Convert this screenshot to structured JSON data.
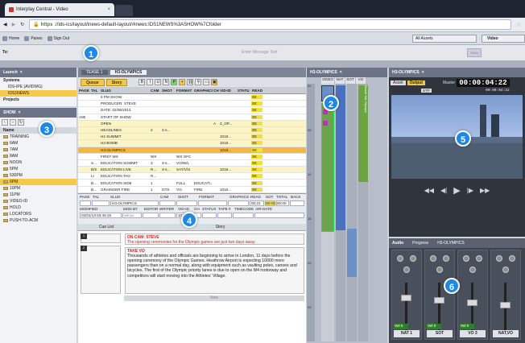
{
  "browser": {
    "tab_title": "Interplay Central - Video",
    "tab_close": "×",
    "url_scheme": "https",
    "url_rest": "://ids-ics/layout/inews-default-layout/#inews:IDS1NEWS%3ASHOW%7Cfolder"
  },
  "toolbar": {
    "home": "Home",
    "panes": "Panes",
    "sign_out": "Sign Out",
    "assets": "All Assets",
    "video": "Video"
  },
  "message": {
    "to_label": "To:",
    "placeholder": "Enter Message Text",
    "send": "Send"
  },
  "launch": {
    "title": "Launch",
    "systems": "Systems",
    "sys1": "IDS-IPE (AVIDWG)",
    "sys2": "IDS1NEWS",
    "projects": "Projects"
  },
  "show": {
    "title": "SHOW",
    "name_hdr": "Name",
    "items": [
      "TRAINING",
      "6AM",
      "7AM",
      "8AM",
      "NOON",
      "5PM",
      "530PM",
      "6PM",
      "10PM",
      "11PM",
      "VIDEO-ID",
      "HOLD",
      "LOCATORS",
      "PUSH-TO-ACM"
    ]
  },
  "story_panel": {
    "tab1": "TEASE 1",
    "tab2": "H3-OLYMPICS",
    "queue": "Queue",
    "story": "Story",
    "headers": [
      "PAGE",
      "TAL",
      "SLUG",
      "CAM",
      "SHOT",
      "FORMAT",
      "GRAPHICS",
      "CH",
      "VID-ID",
      "STATU",
      "READ"
    ],
    "rows": [
      {
        "page": "",
        "tal": "",
        "slug": "6 PM SHOW",
        "cam": "",
        "shot": "",
        "fmt": "",
        "gfx": "",
        "ch": "",
        "vid": "",
        "st": "",
        "rd": "00:",
        "c": "w"
      },
      {
        "page": "",
        "tal": "",
        "slug": "PRODUCER: STEVE",
        "cam": "",
        "shot": "",
        "fmt": "",
        "gfx": "",
        "ch": "",
        "vid": "",
        "st": "",
        "rd": "00:",
        "c": "w"
      },
      {
        "page": "",
        "tal": "",
        "slug": "DATE: 02/06/2013",
        "cam": "",
        "shot": "",
        "fmt": "",
        "gfx": "",
        "ch": "",
        "vid": "",
        "st": "",
        "rd": "00:",
        "c": "w"
      },
      {
        "page": "A00",
        "tal": "",
        "slug": "START OF SHOW",
        "cam": "",
        "shot": "",
        "fmt": "",
        "gfx": "",
        "ch": "",
        "vid": "",
        "st": "",
        "rd": "00:",
        "c": "w"
      },
      {
        "page": "",
        "tal": "",
        "slug": "OPEN",
        "cam": "",
        "shot": "",
        "fmt": "",
        "gfx": "",
        "ch": "A",
        "vid": "Z_OP...",
        "st": "",
        "rd": "00:",
        "c": "y"
      },
      {
        "page": "",
        "tal": "",
        "slug": "HEADLINES",
        "cam": "2",
        "shot": "2-s...",
        "fmt": "",
        "gfx": "",
        "ch": "",
        "vid": "",
        "st": "",
        "rd": "00:",
        "c": "y"
      },
      {
        "page": "",
        "tal": "",
        "slug": "H1-SUMMIT",
        "cam": "",
        "shot": "",
        "fmt": "",
        "gfx": "",
        "ch": "",
        "vid": "1016...",
        "st": "",
        "rd": "00:",
        "c": "y"
      },
      {
        "page": "",
        "tal": "",
        "slug": "H2-BOMB",
        "cam": "",
        "shot": "",
        "fmt": "",
        "gfx": "",
        "ch": "",
        "vid": "1016...",
        "st": "",
        "rd": "00:",
        "c": "y"
      },
      {
        "page": "",
        "tal": "",
        "slug": "H3-OLYMPICS",
        "cam": "",
        "shot": "",
        "fmt": "",
        "gfx": "",
        "ch": "",
        "vid": "1016...",
        "st": "",
        "rd": "00:",
        "c": "o"
      },
      {
        "page": "",
        "tal": "",
        "slug": "FIRST WX",
        "cam": "WX",
        "shot": "",
        "fmt": "WX OFC",
        "gfx": "",
        "ch": "",
        "vid": "",
        "st": "",
        "rd": "00:",
        "c": "w"
      },
      {
        "page": "",
        "tal": "S...",
        "slug": "EDUCATION SUMMIT",
        "cam": "3",
        "shot": "3-s...",
        "fmt": "VO/W/L",
        "gfx": "",
        "ch": "",
        "vid": "",
        "st": "",
        "rd": "00:",
        "c": "w"
      },
      {
        "page": "",
        "tal": "B/S",
        "slug": "EDUCATION LIVE",
        "cam": "R...",
        "shot": "3-s...",
        "fmt": "SAT/V/S",
        "gfx": "",
        "ch": "",
        "vid": "1016...",
        "st": "",
        "rd": "00:",
        "c": "y"
      },
      {
        "page": "",
        "tal": "LI",
        "slug": "EDUCATION TAG",
        "cam": "R...",
        "shot": "",
        "fmt": "",
        "gfx": "",
        "ch": "",
        "vid": "",
        "st": "",
        "rd": "00:",
        "c": "w"
      },
      {
        "page": "",
        "tal": "B...",
        "slug": "EDUCATION SIDE",
        "cam": "1",
        "shot": "",
        "fmt": "FULL",
        "gfx": "EDUCATI...",
        "ch": "",
        "vid": "",
        "st": "",
        "rd": "00:",
        "c": "w"
      },
      {
        "page": "",
        "tal": "B...",
        "slug": "GRAINGER FIRE",
        "cam": "1",
        "shot": "OTS",
        "fmt": "VO",
        "gfx": "FIRE",
        "ch": "",
        "vid": "1016...",
        "st": "",
        "rd": "00:",
        "c": "w"
      }
    ],
    "fh": {
      "page": "PAGE",
      "tal": "TAL",
      "slug": "SLUG",
      "cam": "CAM",
      "shot": "SHOT",
      "format": "FORMAT",
      "graphics": "GRAPHICS",
      "read": "READ",
      "sot": "SOT",
      "total": "TOTAL",
      "back": "BACK"
    },
    "fv": {
      "slug": "H3-OLYMPICS",
      "read": "00:22",
      "sot": "00:00",
      "total": "00:00"
    },
    "fh2": {
      "modified": "MODIFIED",
      "modby": "MOD BY",
      "editor": "EDITOR",
      "writer": "WRITER",
      "vidid": "VID-ID",
      "ch": "CH",
      "status": "STATUS",
      "tape": "TAPE #",
      "timecode": "TIMECODE",
      "airdate": "AIR-DATE"
    },
    "fv2": {
      "modified": "02/01/13 03:46:15",
      "modby": "wilcox",
      "vidid": "1016124"
    },
    "cue_list": "Cue List",
    "story_hdr": "Story",
    "card1_n": "1",
    "card1_title": "ON CAM: STEVE",
    "card1_text": "The opening ceremonies for the Olympic games are just two days away.",
    "card2_n": "2",
    "card2_title": "TAKE VO",
    "card2_text": "Thousands of athletes and officials are beginning to arrive in London, 11 days before the opening ceremony of the Olympic Games. Heathrow Airport is expecting 10000 more passengers than on a normal day, along with equipment such as vaulting poles, canoes and bicycles. The first of the Olympic priority lanes is due to open on the M4 motorway and competitors will start moving into the Athletes' Village.",
    "new_btn": "New"
  },
  "rundown": {
    "tab": "H3-OLYMPICS",
    "cols": [
      "VIDEO",
      "NAT",
      "SOT",
      "VO"
    ],
    "ticks": [
      "00",
      "05",
      "10",
      "15",
      "20",
      "25"
    ],
    "clip_lbl": "Beach Mix Olympic"
  },
  "preview": {
    "title": "H3-OLYMPICS",
    "asset": "Asset",
    "output": "Output",
    "stp": "STP",
    "master": "Master",
    "timecode": "00:00:04:22",
    "sub_tc": "00:00:04:22"
  },
  "mixer": {
    "tab_audio": "Audio",
    "tab_progress": "Progress",
    "tab_seq": "H3-OLYMPICS",
    "channels": [
      {
        "name": "NAT 1",
        "vol": "Vol 0"
      },
      {
        "name": "SOT",
        "vol": "Vol 0"
      },
      {
        "name": "VO 3",
        "vol": "Vol 0"
      },
      {
        "name": "NAT,VO",
        "vol": ""
      }
    ]
  },
  "callouts": [
    "1",
    "2",
    "3",
    "4",
    "5",
    "6"
  ]
}
